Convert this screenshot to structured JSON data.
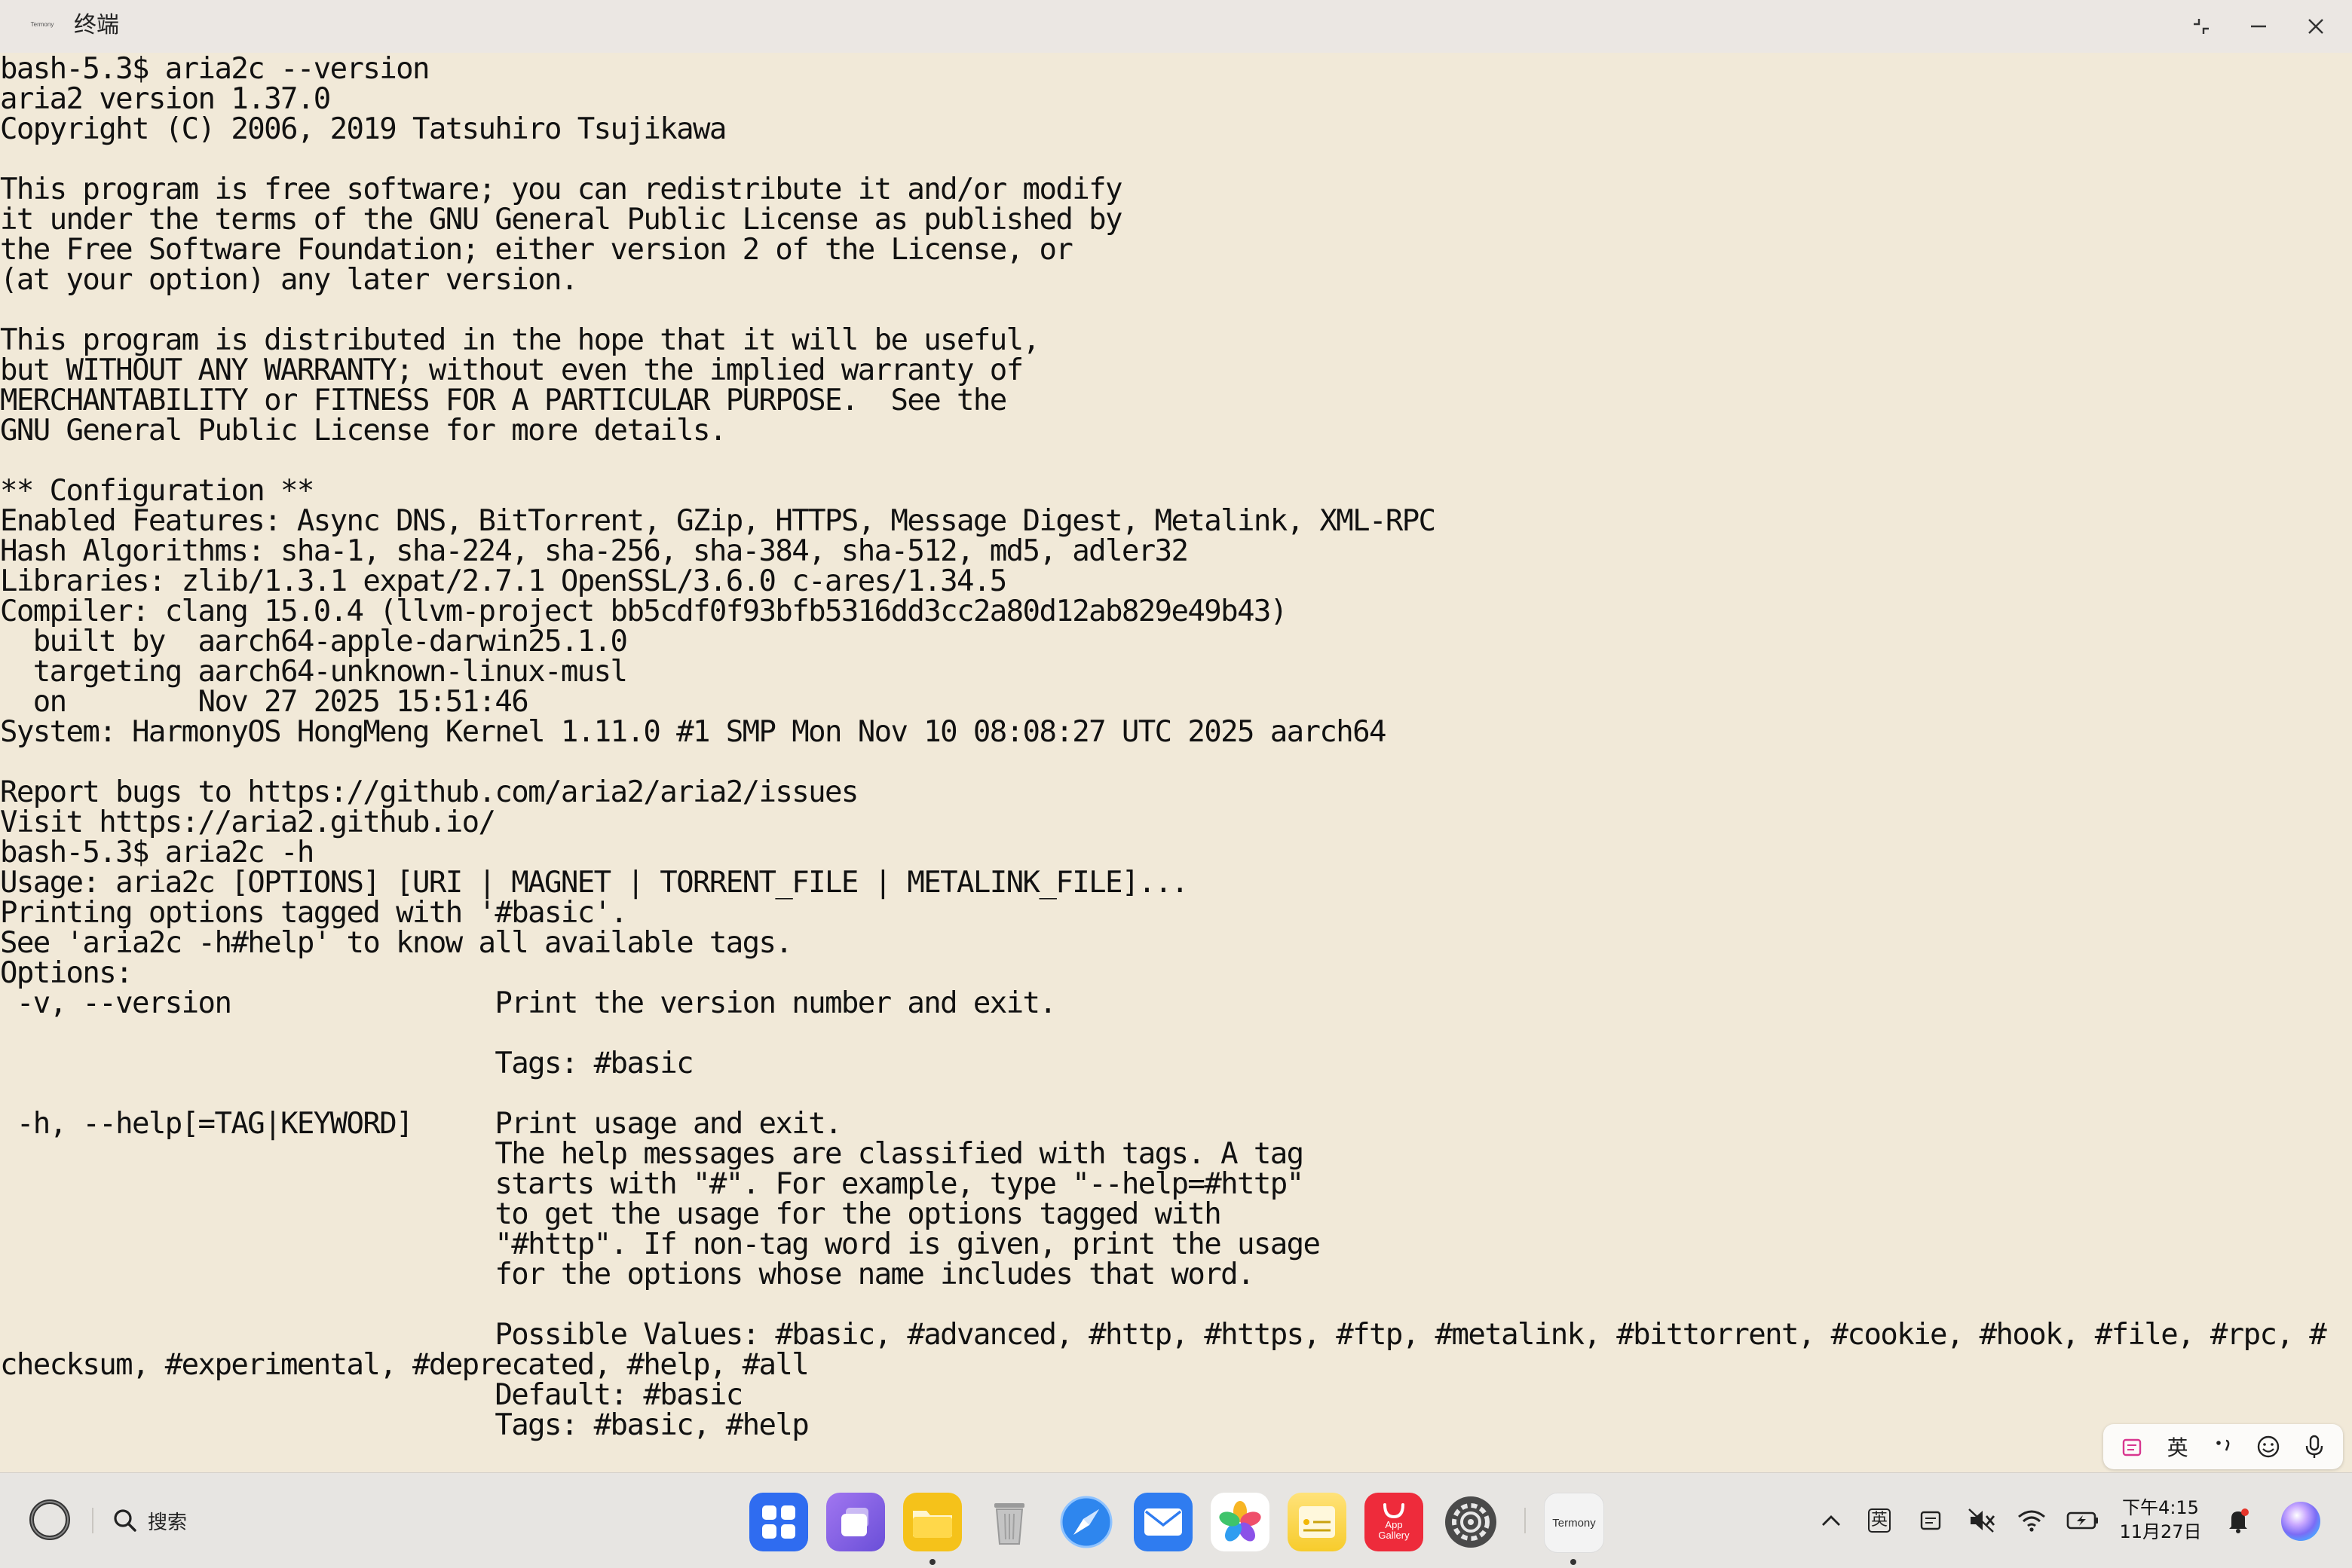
{
  "window": {
    "app_icon_text": "Termony",
    "title": "终端"
  },
  "terminal": {
    "lines": [
      "bash-5.3$ aria2c --version",
      "aria2 version 1.37.0",
      "Copyright (C) 2006, 2019 Tatsuhiro Tsujikawa",
      "",
      "This program is free software; you can redistribute it and/or modify",
      "it under the terms of the GNU General Public License as published by",
      "the Free Software Foundation; either version 2 of the License, or",
      "(at your option) any later version.",
      "",
      "This program is distributed in the hope that it will be useful,",
      "but WITHOUT ANY WARRANTY; without even the implied warranty of",
      "MERCHANTABILITY or FITNESS FOR A PARTICULAR PURPOSE.  See the",
      "GNU General Public License for more details.",
      "",
      "** Configuration **",
      "Enabled Features: Async DNS, BitTorrent, GZip, HTTPS, Message Digest, Metalink, XML-RPC",
      "Hash Algorithms: sha-1, sha-224, sha-256, sha-384, sha-512, md5, adler32",
      "Libraries: zlib/1.3.1 expat/2.7.1 OpenSSL/3.6.0 c-ares/1.34.5",
      "Compiler: clang 15.0.4 (llvm-project bb5cdf0f93bfb5316dd3cc2a80d12ab829e49b43)",
      "  built by  aarch64-apple-darwin25.1.0",
      "  targeting aarch64-unknown-linux-musl",
      "  on        Nov 27 2025 15:51:46",
      "System: HarmonyOS HongMeng Kernel 1.11.0 #1 SMP Mon Nov 10 08:08:27 UTC 2025 aarch64",
      "",
      "Report bugs to https://github.com/aria2/aria2/issues",
      "Visit https://aria2.github.io/",
      "bash-5.3$ aria2c -h",
      "Usage: aria2c [OPTIONS] [URI | MAGNET | TORRENT_FILE | METALINK_FILE]...",
      "Printing options tagged with '#basic'.",
      "See 'aria2c -h#help' to know all available tags.",
      "Options:",
      " -v, --version                Print the version number and exit.",
      "",
      "                              Tags: #basic",
      "",
      " -h, --help[=TAG|KEYWORD]     Print usage and exit.",
      "                              The help messages are classified with tags. A tag",
      "                              starts with \"#\". For example, type \"--help=#http\"",
      "                              to get the usage for the options tagged with",
      "                              \"#http\". If non-tag word is given, print the usage",
      "                              for the options whose name includes that word.",
      "",
      "                              Possible Values: #basic, #advanced, #http, #https, #ftp, #metalink, #bittorrent, #cookie, #hook, #file, #rpc, #",
      "checksum, #experimental, #deprecated, #help, #all",
      "                              Default: #basic",
      "                              Tags: #basic, #help"
    ]
  },
  "ime": {
    "lang_label": "英"
  },
  "taskbar": {
    "search_label": "搜索",
    "apps": [
      {
        "name": "app-center",
        "color": "#2f6cf0"
      },
      {
        "name": "multitask",
        "color": "#7b5ce0"
      },
      {
        "name": "files",
        "color": "#f5c21a"
      },
      {
        "name": "trash",
        "color": "#d9d9d9"
      },
      {
        "name": "browser",
        "color": "#2f8cf0"
      },
      {
        "name": "mail",
        "color": "#2f7cf0"
      },
      {
        "name": "photos",
        "color": "#ffffff"
      },
      {
        "name": "notes",
        "color": "#f7d13a"
      },
      {
        "name": "app-gallery",
        "color": "#ee2b3b",
        "label": "App Gallery"
      },
      {
        "name": "settings",
        "color": "#505050"
      },
      {
        "name": "termony",
        "color": "#f2f2f2",
        "label": "Termony"
      }
    ],
    "tray_lang": "英",
    "clock_time": "下午4:15",
    "clock_date": "11月27日"
  }
}
